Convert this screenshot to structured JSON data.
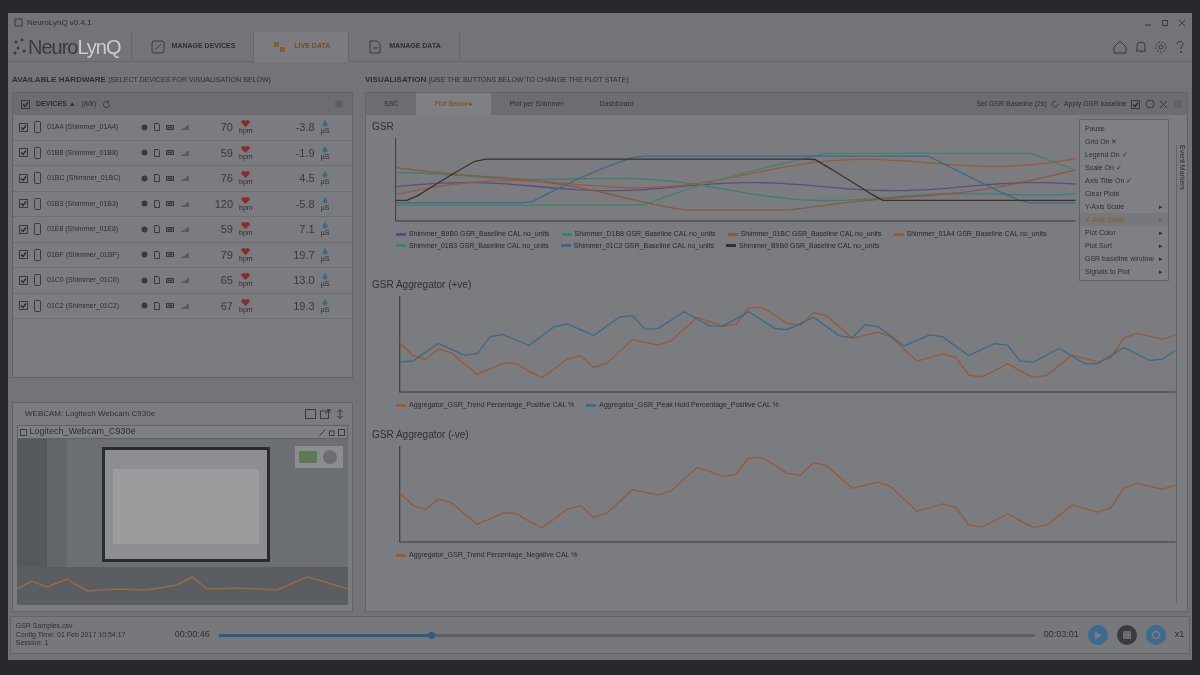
{
  "window": {
    "title": "NeuroLynQ v0.4.1"
  },
  "nav": {
    "logo_main": "Neuro",
    "logo_accent": "LynQ",
    "tabs": [
      {
        "label": "MANAGE DEVICES",
        "selected": false
      },
      {
        "label": "LIVE DATA",
        "selected": true
      },
      {
        "label": "MANAGE DATA",
        "selected": false
      }
    ]
  },
  "hardware": {
    "title": "AVAILABLE HARDWARE",
    "hint": "(SELECT DEVICES FOR VISUALISATION BELOW)",
    "header": {
      "label": "DEVICES ▲",
      "count": "(8/8)",
      "checked": true
    },
    "devices": [
      {
        "name": "01A4 (Shimmer_01A4)",
        "checked": true,
        "hr": "70",
        "hr_unit": "bpm",
        "gsr": "-3.8",
        "gsr_unit": "µS"
      },
      {
        "name": "01B8 (Shimmer_01B8)",
        "checked": true,
        "hr": "59",
        "hr_unit": "bpm",
        "gsr": "-1.9",
        "gsr_unit": "µS"
      },
      {
        "name": "01BC (Shimmer_01BC)",
        "checked": true,
        "hr": "76",
        "hr_unit": "bpm",
        "gsr": "4.5",
        "gsr_unit": "µS"
      },
      {
        "name": "01B3 (Shimmer_01B3)",
        "checked": true,
        "hr": "120",
        "hr_unit": "bpm",
        "gsr": "-5.8",
        "gsr_unit": "µS"
      },
      {
        "name": "01E8 (Shimmer_01E8)",
        "checked": true,
        "hr": "59",
        "hr_unit": "bpm",
        "gsr": "7.1",
        "gsr_unit": "µS"
      },
      {
        "name": "01BF (Shimmer_01BF)",
        "checked": true,
        "hr": "79",
        "hr_unit": "bpm",
        "gsr": "19.7",
        "gsr_unit": "µS"
      },
      {
        "name": "01C0 (Shimmer_01C0)",
        "checked": true,
        "hr": "65",
        "hr_unit": "bpm",
        "gsr": "13.0",
        "gsr_unit": "µS"
      },
      {
        "name": "01C2 (Shimmer_01C2)",
        "checked": true,
        "hr": "67",
        "hr_unit": "bpm",
        "gsr": "19.3",
        "gsr_unit": "µS"
      }
    ]
  },
  "webcam": {
    "title": "WEBCAM: Logitech Webcam C930e",
    "stream": "Logitech_Webcam_C930e"
  },
  "visualisation": {
    "title": "VISUALISATION",
    "hint": "(USE THE BUTTONS BELOW TO CHANGE THE PLOT STATE)",
    "tabs": [
      {
        "label": "SSC",
        "selected": false
      },
      {
        "label": "Plot Below ▸",
        "selected": true
      },
      {
        "label": "Plot per Shimmer",
        "selected": false
      },
      {
        "label": "Dashboard",
        "selected": false
      }
    ],
    "baseline_button": "Set GSR Baseline (2s)",
    "apply_label": "Apply GSR baseline",
    "apply_checked": true,
    "plots": [
      {
        "title": "GSR",
        "legend": [
          {
            "label": "Shimmer_B9B0 GSR_Baseline CAL no_units",
            "color": "#5e4a80"
          },
          {
            "label": "Shimmer_D1B8 GSR_Baseline CAL no_units",
            "color": "#3f7d72"
          },
          {
            "label": "Shimmer_01BC GSR_Baseline CAL no_units",
            "color": "#8a5a3a"
          },
          {
            "label": "Shimmer_01A4 GSR_Baseline CAL no_units",
            "color": "#9a5a35"
          },
          {
            "label": "Shimmer_01B3 GSR_Baseline CAL no_units",
            "color": "#44806f"
          },
          {
            "label": "Shimmer_01C2 GSR_Baseline CAL no_units",
            "color": "#3d6a86"
          },
          {
            "label": "Shimmer_B9B0 GSR_Baseline CAL no_units",
            "color": "#3e2e2e"
          }
        ]
      },
      {
        "title": "GSR Aggregator (+ve)",
        "legend": [
          {
            "label": "Aggregator_GSR_Trend Percentage_Positive CAL %",
            "color": "#9a5a35"
          },
          {
            "label": "Aggregator_GSR_Peak Hold Percentage_Positive CAL %",
            "color": "#3d6a86"
          }
        ]
      },
      {
        "title": "GSR Aggregator (-ve)",
        "legend": [
          {
            "label": "Aggregator_GSR_Trend Percentage_Negative CAL %",
            "color": "#9a5a35"
          }
        ]
      }
    ],
    "menu": [
      {
        "label": "Pause",
        "selected": false
      },
      {
        "label": "Grid On",
        "suffix": "✕",
        "selected": false
      },
      {
        "label": "Legend On",
        "suffix": "✓",
        "selected": false
      },
      {
        "label": "Scale On",
        "suffix": "✓",
        "selected": false
      },
      {
        "label": "Axis Title On",
        "suffix": "✓",
        "selected": false
      },
      {
        "label": "Clear Plots",
        "selected": false
      },
      {
        "label": "Y-Axis Scale",
        "suffix": "▸",
        "selected": false
      },
      {
        "label": "X-Axis Scale",
        "suffix": "▸",
        "selected": true
      },
      {
        "label": "Plot Color",
        "suffix": "▸",
        "selected": false
      },
      {
        "label": "Plot Sort",
        "suffix": "▸",
        "selected": false
      },
      {
        "label": "GSR baseline window",
        "suffix": "▸",
        "selected": false
      },
      {
        "label": "Signals to Plot",
        "suffix": "▸",
        "selected": false
      }
    ],
    "side_tab": "Event Markers"
  },
  "player": {
    "file": "GSR Samples.csv",
    "config": "Config Time: 01 Feb 2017 10:54:17",
    "session": "Session: 1",
    "elapsed": "00:00:46",
    "total": "00:03:01",
    "level": 0.26,
    "speed": "x1"
  }
}
